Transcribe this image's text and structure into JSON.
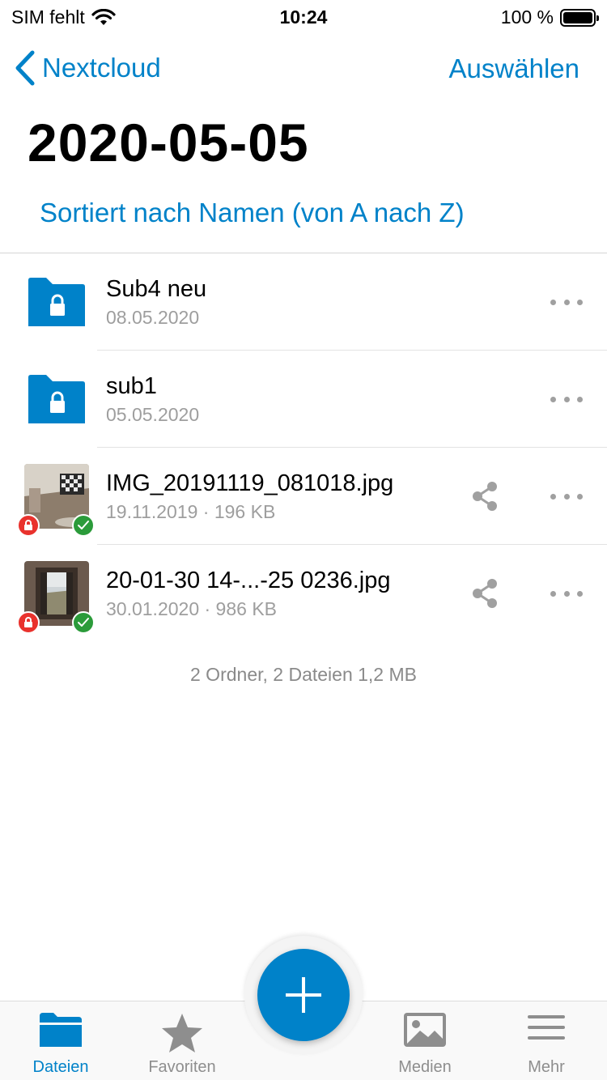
{
  "status_bar": {
    "carrier": "SIM fehlt",
    "time": "10:24",
    "battery": "100 %"
  },
  "nav": {
    "back_label": "Nextcloud",
    "select_label": "Auswählen"
  },
  "page": {
    "title": "2020-05-05",
    "sort_label": "Sortiert nach Namen (von A nach Z)"
  },
  "files": [
    {
      "name": "Sub4 neu",
      "meta": "08.05.2020",
      "type": "folder-locked"
    },
    {
      "name": "sub1",
      "meta": "05.05.2020",
      "type": "folder-locked"
    },
    {
      "name": "IMG_20191119_081018.jpg",
      "meta": "19.11.2019 · 196 KB",
      "type": "image"
    },
    {
      "name": "20-01-30 14-...-25 0236.jpg",
      "meta": "30.01.2020 · 986 KB",
      "type": "image"
    }
  ],
  "summary": "2 Ordner, 2 Dateien 1,2 MB",
  "tabs": [
    {
      "label": "Dateien",
      "icon": "folder-icon",
      "active": true
    },
    {
      "label": "Favoriten",
      "icon": "star-icon",
      "active": false
    },
    {
      "label": "Medien",
      "icon": "image-icon",
      "active": false
    },
    {
      "label": "Mehr",
      "icon": "menu-icon",
      "active": false
    }
  ],
  "colors": {
    "accent": "#0082c9",
    "lock_badge": "#e9322d",
    "synced_badge": "#2b9b3a"
  }
}
